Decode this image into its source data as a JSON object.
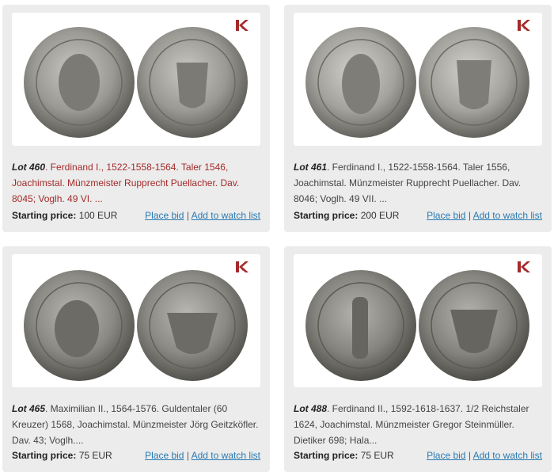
{
  "brand_color": "#a52a2a",
  "link_color": "#2a7ab0",
  "logo_icon": "auction-house-logo-icon",
  "lots": [
    {
      "lot_label": "Lot 460",
      "description": ". Ferdinand I., 1522-1558-1564. Taler 1546, Joachimstal. Münzmeister Rupprecht Puellacher. Dav. 8045; Voglh. 49 VI. ...",
      "highlighted": true,
      "price_label": "Starting price:",
      "price_value": "100 EUR",
      "bid_label": "Place bid",
      "separator": "|",
      "watch_label": "Add to watch list"
    },
    {
      "lot_label": "Lot 461",
      "description": ". Ferdinand I., 1522-1558-1564. Taler 1556, Joachimstal. Münzmeister Rupprecht Puellacher. Dav. 8046; Voglh. 49 VII. ...",
      "highlighted": false,
      "price_label": "Starting price:",
      "price_value": "200 EUR",
      "bid_label": "Place bid",
      "separator": "|",
      "watch_label": "Add to watch list"
    },
    {
      "lot_label": "Lot 465",
      "description": ". Maximilian II., 1564-1576. Guldentaler (60 Kreuzer) 1568, Joachimstal. Münzmeister Jörg Geitzköfler. Dav. 43; Voglh....",
      "highlighted": false,
      "price_label": "Starting price:",
      "price_value": "75 EUR",
      "bid_label": "Place bid",
      "separator": "|",
      "watch_label": "Add to watch list"
    },
    {
      "lot_label": "Lot 488",
      "description": ". Ferdinand II., 1592-1618-1637. 1/2 Reichstaler 1624, Joachimstal. Münzmeister Gregor Steinmüller. Dietiker 698; Hala...",
      "highlighted": false,
      "price_label": "Starting price:",
      "price_value": "75 EUR",
      "bid_label": "Place bid",
      "separator": "|",
      "watch_label": "Add to watch list"
    }
  ]
}
